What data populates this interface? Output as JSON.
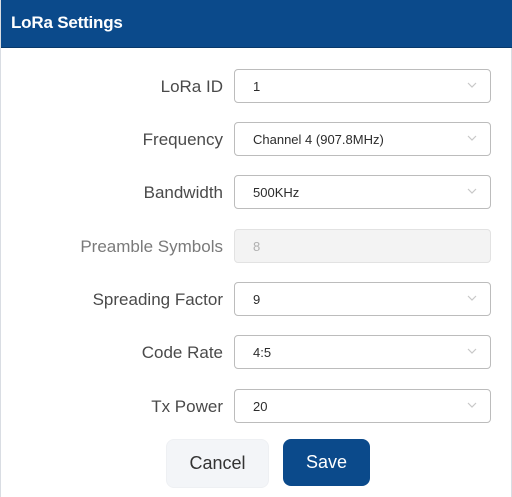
{
  "header": {
    "title": "LoRa Settings"
  },
  "fields": [
    {
      "label": "LoRa ID",
      "value": "1",
      "type": "select"
    },
    {
      "label": "Frequency",
      "value": "Channel 4 (907.8MHz)",
      "type": "select"
    },
    {
      "label": "Bandwidth",
      "value": "500KHz",
      "type": "select"
    },
    {
      "label": "Preamble Symbols",
      "value": "8",
      "type": "input",
      "disabled": true
    },
    {
      "label": "Spreading Factor",
      "value": "9",
      "type": "select"
    },
    {
      "label": "Code Rate",
      "value": "4:5",
      "type": "select"
    },
    {
      "label": "Tx Power",
      "value": "20",
      "type": "select"
    }
  ],
  "actions": {
    "cancel_label": "Cancel",
    "save_label": "Save"
  },
  "colors": {
    "brand": "#0b4a8b",
    "cancel_bg": "#f3f5f8",
    "disabled_bg": "#f3f3f3"
  },
  "icons": {
    "dropdown": "chevron-down-icon"
  }
}
